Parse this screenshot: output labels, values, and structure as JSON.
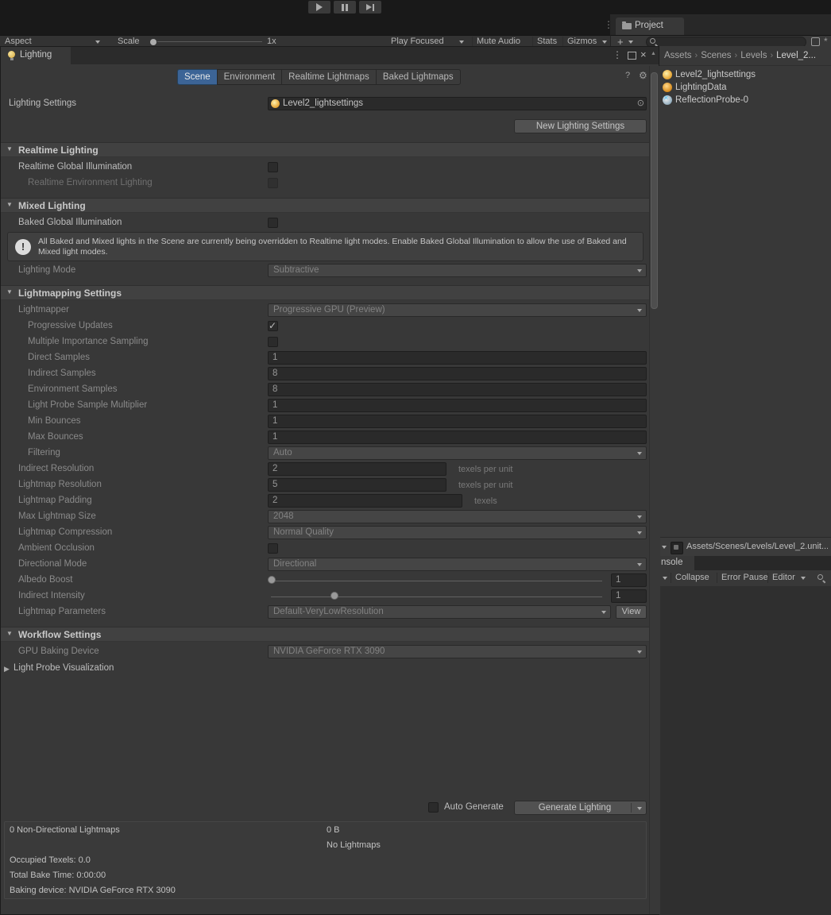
{
  "glyphs": {
    "caret": "▾",
    "kebab": "⋮",
    "close": "×",
    "help": "?",
    "gear": "⚙",
    "picker": "⊙",
    "check": "✓",
    "crumb_sep": "›",
    "fold_open": "▼",
    "fold_closed": "▶",
    "scroll_up": "▲",
    "exclaim": "!",
    "plus": "+",
    "star": "*"
  },
  "game_toolbar": {
    "aspect": "Aspect",
    "scale": "Scale",
    "zoom": "1x",
    "play_focused": "Play Focused",
    "mute_audio": "Mute Audio",
    "stats": "Stats",
    "gizmos": "Gizmos"
  },
  "project": {
    "tab": "Project",
    "breadcrumbs": [
      "Assets",
      "Scenes",
      "Levels",
      "Level_2..."
    ],
    "items": [
      "Level2_lightsettings",
      "LightingData",
      "ReflectionProbe-0"
    ],
    "selected_path": "Assets/Scenes/Levels/Level_2.unit..."
  },
  "console": {
    "tab_partial": "nsole",
    "collapse": "Collapse",
    "error_pause": "Error Pause",
    "editor": "Editor"
  },
  "lw": {
    "title": "Lighting",
    "tabs": [
      "Scene",
      "Environment",
      "Realtime Lightmaps",
      "Baked Lightmaps"
    ],
    "active_tab": "Scene",
    "settings_label": "Lighting Settings",
    "settings_value": "Level2_lightsettings",
    "new_button": "New Lighting Settings",
    "realtime": {
      "title": "Realtime Lighting",
      "gi_label": "Realtime Global Illumination",
      "gi_checked": false,
      "env_label": "Realtime Environment Lighting",
      "env_checked": false
    },
    "mixed": {
      "title": "Mixed Lighting",
      "baked_gi_label": "Baked Global Illumination",
      "baked_gi_checked": false,
      "warning": "All Baked and Mixed lights in the Scene are currently being overridden to Realtime light modes. Enable Baked Global Illumination to allow the use of Baked and Mixed light modes.",
      "mode_label": "Lighting Mode",
      "mode_value": "Subtractive"
    },
    "lightmapping": {
      "title": "Lightmapping Settings",
      "rows": [
        {
          "label": "Lightmapper",
          "value": "Progressive GPU (Preview)"
        },
        {
          "label": "Progressive Updates",
          "checked": true
        },
        {
          "label": "Multiple Importance Sampling",
          "checked": false
        },
        {
          "label": "Direct Samples",
          "value": "1"
        },
        {
          "label": "Indirect Samples",
          "value": "8"
        },
        {
          "label": "Environment Samples",
          "value": "8"
        },
        {
          "label": "Light Probe Sample Multiplier",
          "value": "1"
        },
        {
          "label": "Min Bounces",
          "value": "1"
        },
        {
          "label": "Max Bounces",
          "value": "1"
        },
        {
          "label": "Filtering",
          "value": "Auto"
        },
        {
          "label": "Indirect Resolution",
          "value": "2",
          "suffix": "texels per unit"
        },
        {
          "label": "Lightmap Resolution",
          "value": "5",
          "suffix": "texels per unit"
        },
        {
          "label": "Lightmap Padding",
          "value": "2",
          "suffix": "texels"
        },
        {
          "label": "Max Lightmap Size",
          "value": "2048"
        },
        {
          "label": "Lightmap Compression",
          "value": "Normal Quality"
        },
        {
          "label": "Ambient Occlusion",
          "checked": false
        },
        {
          "label": "Directional Mode",
          "value": "Directional"
        },
        {
          "label": "Albedo Boost",
          "value": "1",
          "slider_pos": 0.0
        },
        {
          "label": "Indirect Intensity",
          "value": "1",
          "slider_pos": 0.19
        },
        {
          "label": "Lightmap Parameters",
          "value": "Default-VeryLowResolution",
          "button": "View"
        }
      ]
    },
    "workflow": {
      "title": "Workflow Settings",
      "gpu_label": "GPU Baking Device",
      "gpu_value": "NVIDIA GeForce RTX 3090",
      "probe_label": "Light Probe Visualization"
    },
    "footer": {
      "auto_generate": "Auto Generate",
      "auto_generate_checked": false,
      "generate": "Generate Lighting"
    },
    "stats": {
      "lightmaps": "0 Non-Directional Lightmaps",
      "size": "0 B",
      "no_lightmaps": "No Lightmaps",
      "occupied": "Occupied Texels: 0.0",
      "bake_time": "Total Bake Time: 0:00:00",
      "device": "Baking device: NVIDIA GeForce RTX 3090"
    },
    "colors": {
      "selected_tab": "#3C6496",
      "window_bg": "#383838",
      "field_bg": "#2A2A2A"
    }
  }
}
